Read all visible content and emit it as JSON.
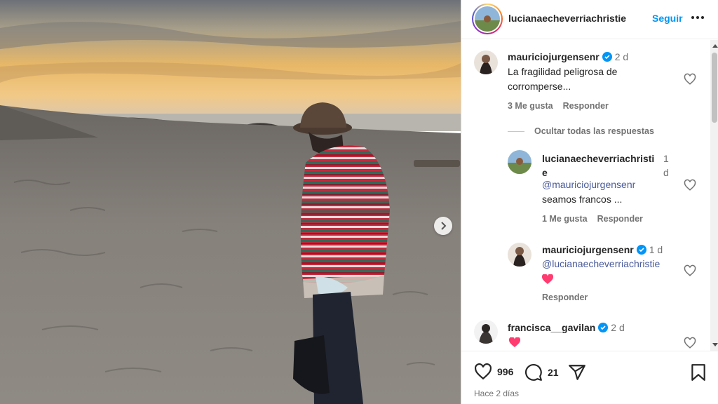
{
  "header": {
    "username": "lucianaecheverriachristie",
    "follow_label": "Seguir",
    "more_icon": "more-horizontal-icon"
  },
  "comments": {
    "c1": {
      "username": "mauriciojurgensenr",
      "time": "2 d",
      "text_line1": "La fragilidad peligrosa de",
      "text_line2": "corromperse...",
      "likes": "3 Me gusta",
      "reply_label": "Responder"
    },
    "hide_replies_label": "Ocultar todas las respuestas",
    "r1": {
      "username_line1": "lucianaecheverriachristi",
      "username_line2": "e",
      "time_line1": "1",
      "time_line2": "d",
      "mention": "@mauriciojurgensenr",
      "text": "seamos francos ...",
      "likes": "1 Me gusta",
      "reply_label": "Responder"
    },
    "r2": {
      "username": "mauriciojurgensenr",
      "time": "1 d",
      "mention": "@lucianaecheverriachristie",
      "emoji": "heart",
      "reply_label": "Responder"
    },
    "c2": {
      "username": "francisca__gavilan",
      "time": "2 d",
      "emoji": "heart"
    }
  },
  "actions": {
    "likes_count": "996",
    "comments_count": "21",
    "posted_ago": "Hace 2 días"
  },
  "colors": {
    "accent": "#0095f6",
    "verified": "#0095f6",
    "heart": "#ff3b6f",
    "muted": "#737373"
  }
}
